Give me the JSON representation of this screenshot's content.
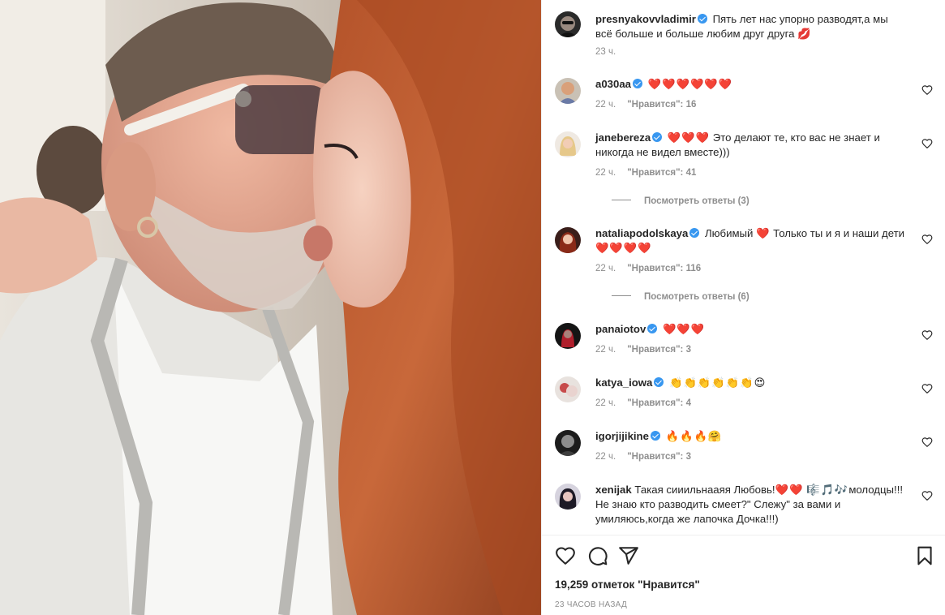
{
  "post": {
    "author": "presnyakovvladimir",
    "caption": "Пять лет нас упорно разводят,а мы всё больше и больше любим друг друга 💋",
    "time": "23 ч."
  },
  "comments": [
    {
      "user": "a030aa",
      "text": "",
      "emoji": "❤️❤️❤️❤️❤️❤️",
      "time": "22 ч.",
      "likes": "\"Нравится\": 16",
      "verified": true
    },
    {
      "user": "janebereza",
      "text": "Это делают те, кто вас не знает и никогда не видел вместе)))",
      "emoji": "❤️❤️❤️",
      "time": "22 ч.",
      "likes": "\"Нравится\": 41",
      "verified": true,
      "replies": "Посмотреть ответы (3)"
    },
    {
      "user": "nataliapodolskaya",
      "text_a": "Любимый",
      "emoji_a": "❤️",
      "text_b": "Только ты и я и наши дети",
      "emoji_b": "❤️❤️❤️❤️",
      "time": "22 ч.",
      "likes": "\"Нравится\": 116",
      "verified": true,
      "replies": "Посмотреть ответы (6)"
    },
    {
      "user": "panaiotov",
      "text": "",
      "emoji": "❤️❤️❤️",
      "time": "22 ч.",
      "likes": "\"Нравится\": 3",
      "verified": true
    },
    {
      "user": "katya_iowa",
      "text": "",
      "emoji": "👏👏👏👏👏👏😍",
      "time": "22 ч.",
      "likes": "\"Нравится\": 4",
      "verified": true
    },
    {
      "user": "igorjijikine",
      "text": "",
      "emoji": "🔥🔥🔥🤗",
      "time": "22 ч.",
      "likes": "\"Нравится\": 3",
      "verified": true
    },
    {
      "user": "xenijak",
      "text_a": "Такая сииильнааяя Любовь!",
      "emoji_a": "❤️❤️",
      "emoji_b": "🎼🎵🎶",
      "text_b": "молодцы!!! Не знаю кто разводить смеет?\" Слежу\" за вами и умиляюсь,когда же лапочка Дочка!!!)",
      "verified": false
    }
  ],
  "footer": {
    "likes": "19,259 отметок \"Нравится\"",
    "ago": "23 ЧАСОВ НАЗАД"
  },
  "icons": {
    "like": "heart-outline-icon",
    "comment": "comment-icon",
    "share": "paper-plane-icon",
    "save": "bookmark-icon"
  },
  "colors": {
    "verified": "#3897f0",
    "muted": "#8e8e8e",
    "text": "#262626",
    "heart": "#e0203a"
  }
}
